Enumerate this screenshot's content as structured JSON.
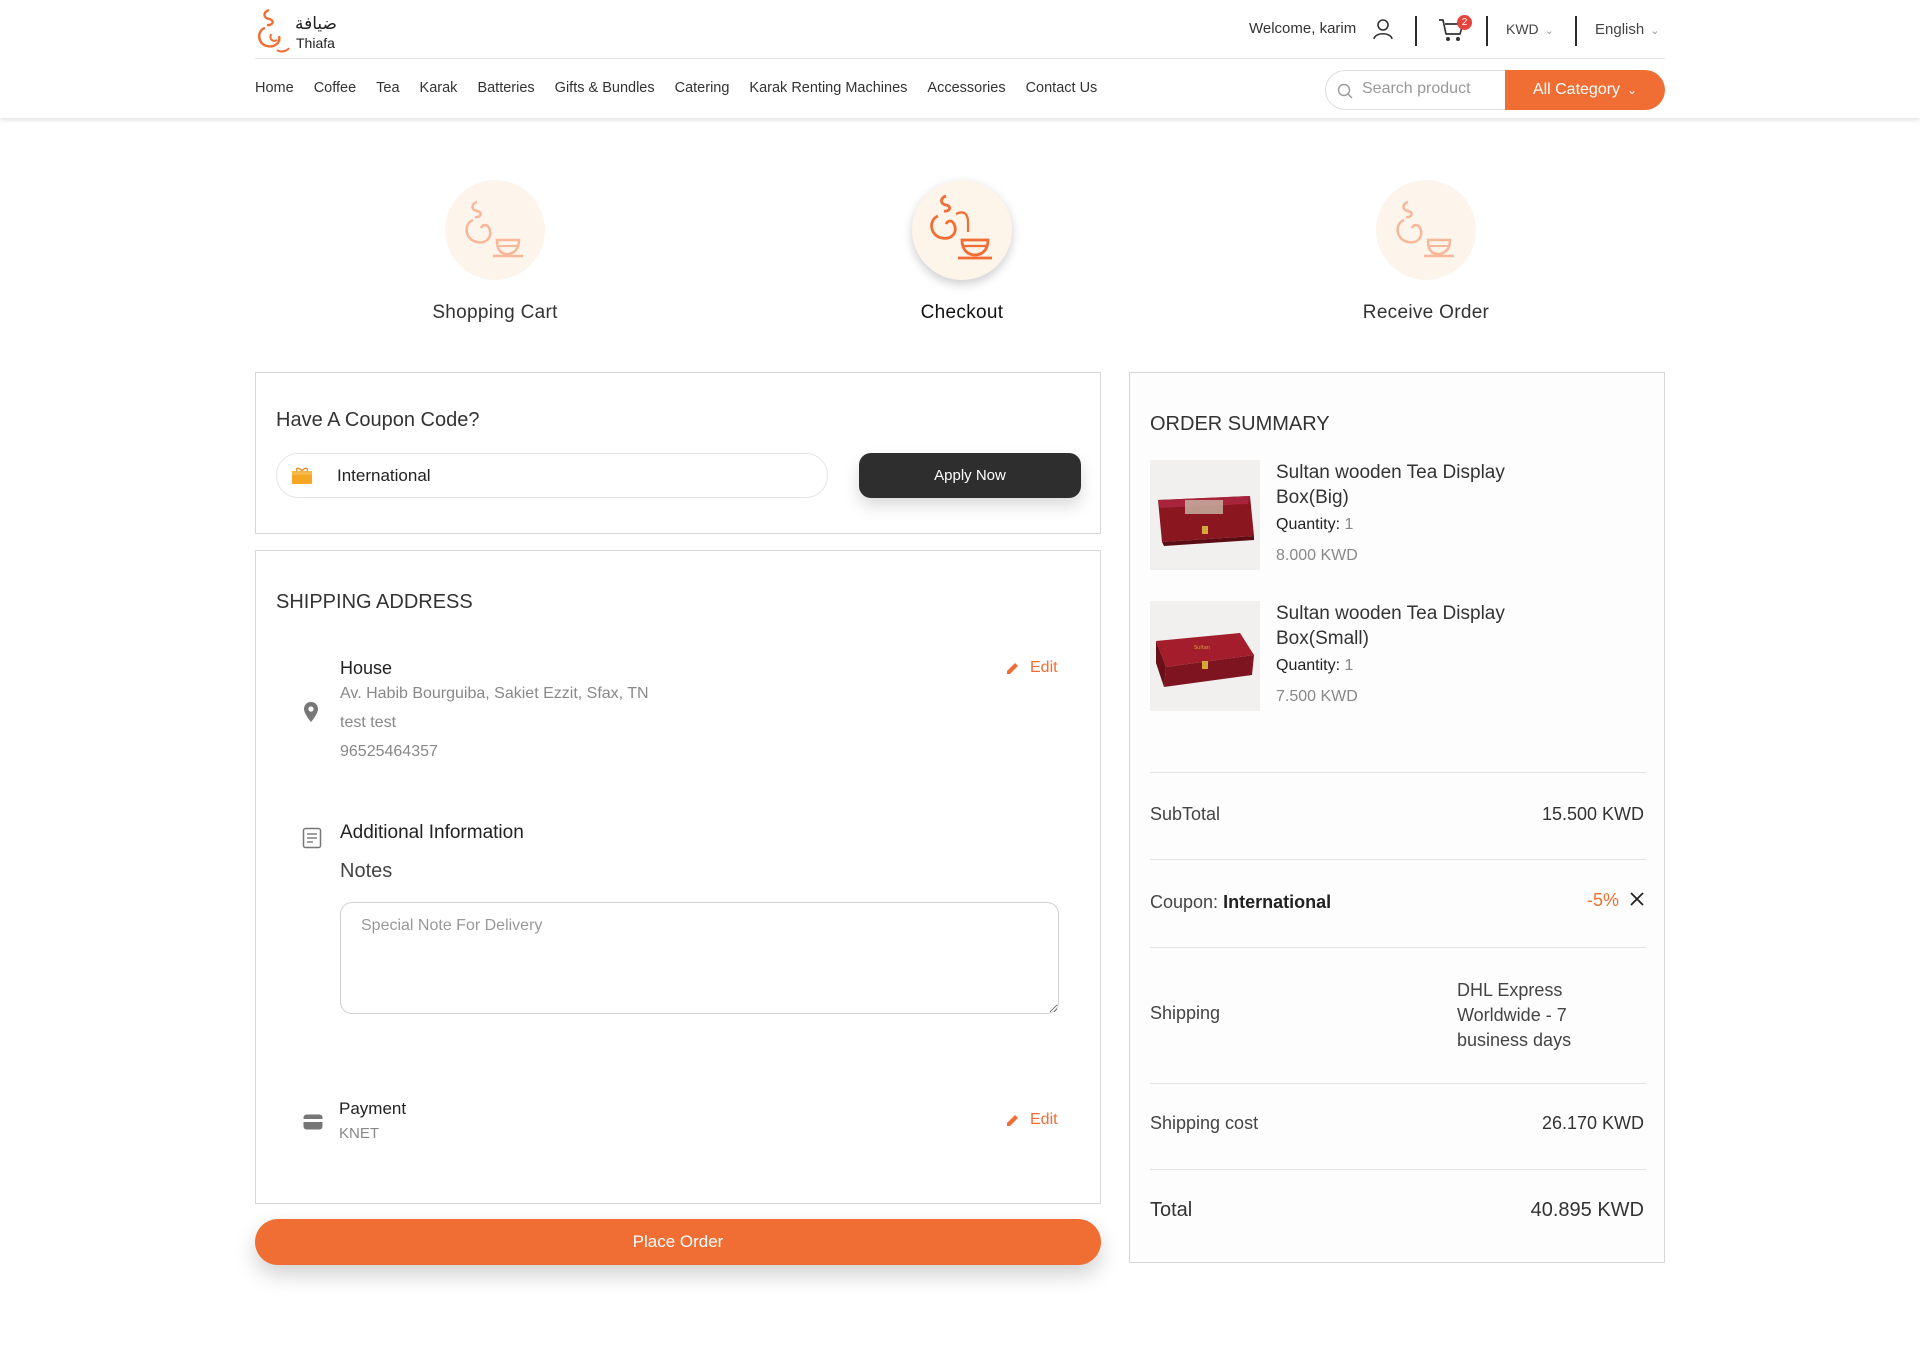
{
  "brand": {
    "name_ar": "ضيافة",
    "name_en": "Thiafa",
    "accent_color": "#f06d33"
  },
  "header": {
    "welcome": "Welcome, karim",
    "cart_count": "2",
    "currency": "KWD",
    "language": "English",
    "nav": [
      "Home",
      "Coffee",
      "Tea",
      "Karak",
      "Batteries",
      "Gifts & Bundles",
      "Catering",
      "Karak Renting Machines",
      "Accessories",
      "Contact Us"
    ],
    "search_placeholder": "Search product",
    "category_label": "All Category"
  },
  "steps": [
    {
      "label": "Shopping Cart",
      "state": "inactive"
    },
    {
      "label": "Checkout",
      "state": "active"
    },
    {
      "label": "Receive Order",
      "state": "inactive"
    }
  ],
  "coupon": {
    "title": "Have A Coupon Code?",
    "value": "International",
    "apply_label": "Apply Now"
  },
  "shipping": {
    "title": "SHIPPING ADDRESS",
    "address_name": "House",
    "address_line": "Av. Habib Bourguiba, Sakiet Ezzit, Sfax, TN",
    "recipient": "test test",
    "phone": "96525464357",
    "edit_label": "Edit",
    "additional_title": "Additional Information",
    "notes_label": "Notes",
    "notes_placeholder": "Special Note For Delivery",
    "payment_title": "Payment",
    "payment_value": "KNET"
  },
  "place_order_label": "Place Order",
  "summary": {
    "title": "ORDER SUMMARY",
    "items": [
      {
        "name": "Sultan wooden Tea Display Box(Big)",
        "qty_label": "Quantity:",
        "qty": "1",
        "price": "8.000 KWD"
      },
      {
        "name": "Sultan wooden Tea Display Box(Small)",
        "qty_label": "Quantity:",
        "qty": "1",
        "price": "7.500 KWD"
      }
    ],
    "subtotal_label": "SubTotal",
    "subtotal": "15.500 KWD",
    "coupon_label": "Coupon:",
    "coupon_code": "International",
    "coupon_discount": "-5%",
    "shipping_label": "Shipping",
    "shipping_method": "DHL Express Worldwide - 7 business days",
    "shipping_cost_label": "Shipping cost",
    "shipping_cost": "26.170 KWD",
    "total_label": "Total",
    "total": "40.895 KWD"
  }
}
